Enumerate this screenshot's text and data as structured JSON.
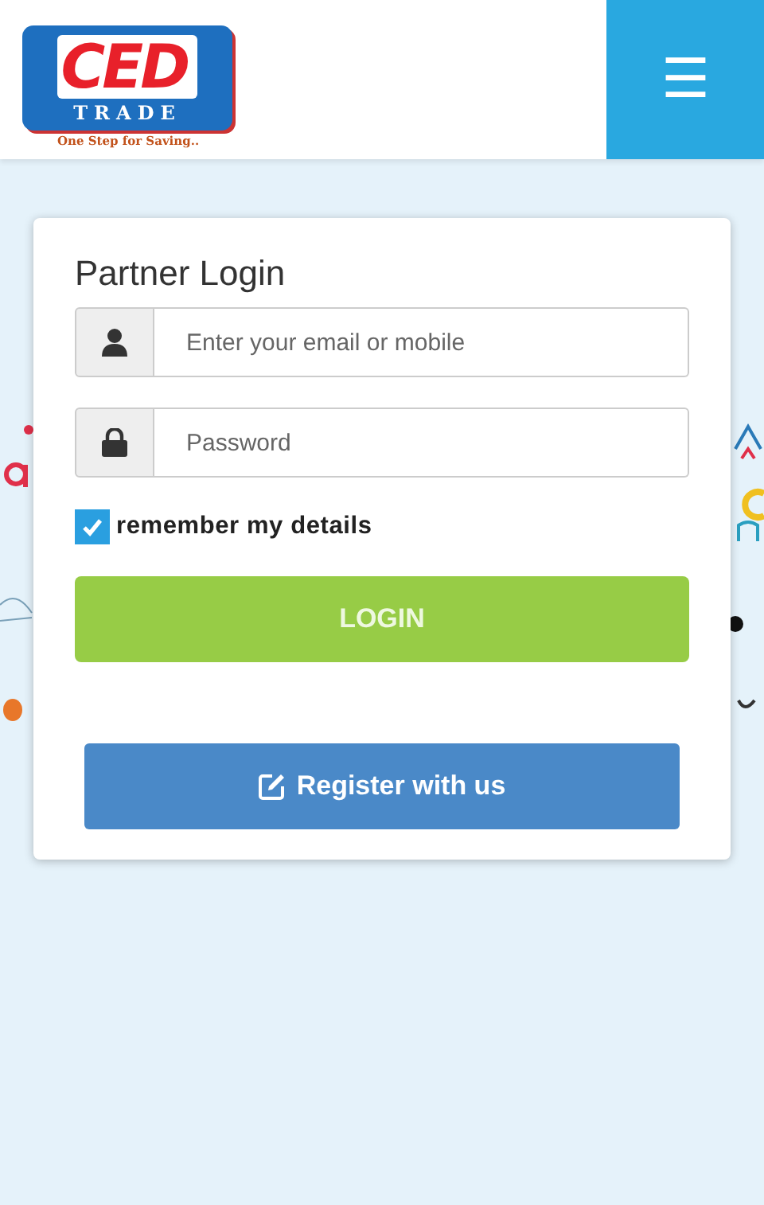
{
  "header": {
    "logo": {
      "mark": "CED",
      "name": "TRADE",
      "tagline": "One Step for Saving.."
    },
    "menu_button": {
      "label": "☰"
    }
  },
  "login": {
    "title": "Partner Login",
    "fields": [
      {
        "kind": "user",
        "placeholder": "Enter your email or mobile"
      },
      {
        "kind": "password",
        "placeholder": "Password"
      }
    ],
    "remember": {
      "label": "remember my details",
      "checked": true
    },
    "login_button": "LOGIN",
    "register_button": "Register with us"
  }
}
